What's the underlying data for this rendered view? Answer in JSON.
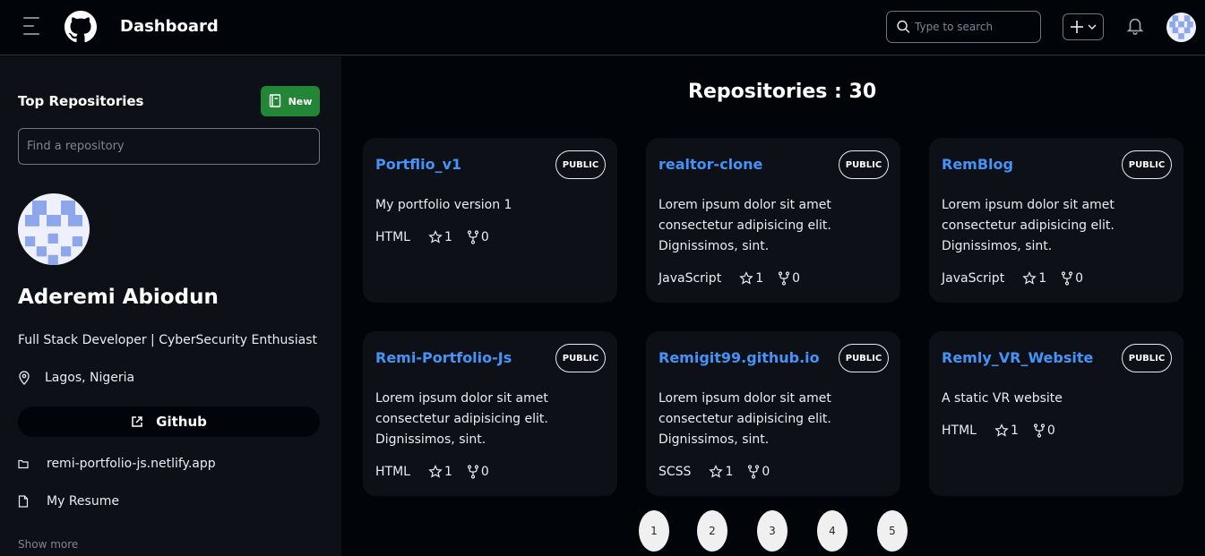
{
  "header": {
    "title": "Dashboard",
    "search_placeholder": "Type to search"
  },
  "sidebar": {
    "heading": "Top Repositories",
    "new_label": "New",
    "find_placeholder": "Find a repository",
    "name": "Aderemi Abiodun",
    "bio": "Full Stack Developer | CyberSecurity Enthusiast",
    "location": "Lagos, Nigeria",
    "github_label": "Github",
    "website": "remi-portfolio-js.netlify.app",
    "resume": "My Resume",
    "show_more": "Show more"
  },
  "main": {
    "heading": "Repositories : 30",
    "repos": [
      {
        "name": "Portflio_v1",
        "visibility": "PUBLIC",
        "description": "My portfolio version 1",
        "language": "HTML",
        "stars": "1",
        "forks": "0"
      },
      {
        "name": "realtor-clone",
        "visibility": "PUBLIC",
        "description": "Lorem ipsum dolor sit amet consectetur adipisicing elit. Dignissimos, sint.",
        "language": "JavaScript",
        "stars": "1",
        "forks": "0"
      },
      {
        "name": "RemBlog",
        "visibility": "PUBLIC",
        "description": "Lorem ipsum dolor sit amet consectetur adipisicing elit. Dignissimos, sint.",
        "language": "JavaScript",
        "stars": "1",
        "forks": "0"
      },
      {
        "name": "Remi-Portfolio-Js",
        "visibility": "PUBLIC",
        "description": "Lorem ipsum dolor sit amet consectetur adipisicing elit. Dignissimos, sint.",
        "language": "HTML",
        "stars": "1",
        "forks": "0"
      },
      {
        "name": "Remigit99.github.io",
        "visibility": "PUBLIC",
        "description": "Lorem ipsum dolor sit amet consectetur adipisicing elit. Dignissimos, sint.",
        "language": "SCSS",
        "stars": "1",
        "forks": "0"
      },
      {
        "name": "Remly_VR_Website",
        "visibility": "PUBLIC",
        "description": "A static VR website",
        "language": "HTML",
        "stars": "1",
        "forks": "0"
      }
    ],
    "pages": [
      "1",
      "2",
      "3",
      "4",
      "5"
    ]
  },
  "colors": {
    "background": "#010409",
    "panel": "#0d1117",
    "link": "#4493f8",
    "new_button": "#238636"
  }
}
